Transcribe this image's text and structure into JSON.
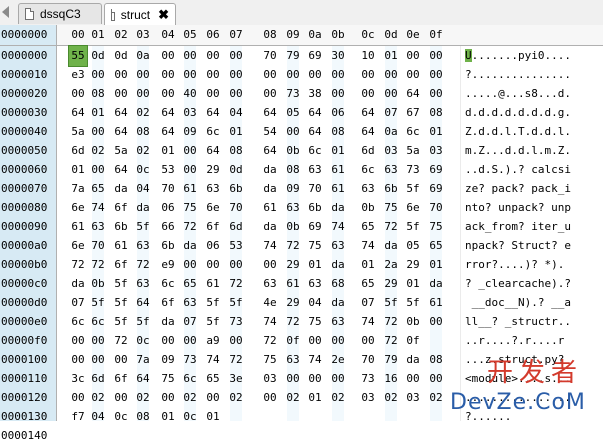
{
  "tabs": [
    {
      "label": "dssqC3",
      "active": false
    },
    {
      "label": "struct",
      "active": true,
      "close": "✖"
    }
  ],
  "header": {
    "address": "0000000",
    "columns": [
      "00",
      "01",
      "02",
      "03",
      "04",
      "05",
      "06",
      "07",
      "08",
      "09",
      "0a",
      "0b",
      "0c",
      "0d",
      "0e",
      "0f"
    ]
  },
  "rows": [
    {
      "addr": "0000000",
      "hex": [
        "55",
        "0d",
        "0d",
        "0a",
        "00",
        "00",
        "00",
        "00",
        "70",
        "79",
        "69",
        "30",
        "10",
        "01",
        "00",
        "00"
      ],
      "ascii": "U.......pyi0...."
    },
    {
      "addr": "0000010",
      "hex": [
        "e3",
        "00",
        "00",
        "00",
        "00",
        "00",
        "00",
        "00",
        "00",
        "00",
        "00",
        "00",
        "00",
        "00",
        "00",
        "00"
      ],
      "ascii": "?..............."
    },
    {
      "addr": "0000020",
      "hex": [
        "00",
        "08",
        "00",
        "00",
        "00",
        "40",
        "00",
        "00",
        "00",
        "73",
        "38",
        "00",
        "00",
        "00",
        "64",
        "00"
      ],
      "ascii": ".....@...s8...d."
    },
    {
      "addr": "0000030",
      "hex": [
        "64",
        "01",
        "64",
        "02",
        "64",
        "03",
        "64",
        "04",
        "64",
        "05",
        "64",
        "06",
        "64",
        "07",
        "67",
        "08"
      ],
      "ascii": "d.d.d.d.d.d.d.g."
    },
    {
      "addr": "0000040",
      "hex": [
        "5a",
        "00",
        "64",
        "08",
        "64",
        "09",
        "6c",
        "01",
        "54",
        "00",
        "64",
        "08",
        "64",
        "0a",
        "6c",
        "01"
      ],
      "ascii": "Z.d.d.l.T.d.d.l."
    },
    {
      "addr": "0000050",
      "hex": [
        "6d",
        "02",
        "5a",
        "02",
        "01",
        "00",
        "64",
        "08",
        "64",
        "0b",
        "6c",
        "01",
        "6d",
        "03",
        "5a",
        "03"
      ],
      "ascii": "m.Z...d.d.l.m.Z."
    },
    {
      "addr": "0000060",
      "hex": [
        "01",
        "00",
        "64",
        "0c",
        "53",
        "00",
        "29",
        "0d",
        "da",
        "08",
        "63",
        "61",
        "6c",
        "63",
        "73",
        "69"
      ],
      "ascii": "..d.S.).? calcsi"
    },
    {
      "addr": "0000070",
      "hex": [
        "7a",
        "65",
        "da",
        "04",
        "70",
        "61",
        "63",
        "6b",
        "da",
        "09",
        "70",
        "61",
        "63",
        "6b",
        "5f",
        "69"
      ],
      "ascii": "ze? pack? pack_i"
    },
    {
      "addr": "0000080",
      "hex": [
        "6e",
        "74",
        "6f",
        "da",
        "06",
        "75",
        "6e",
        "70",
        "61",
        "63",
        "6b",
        "da",
        "0b",
        "75",
        "6e",
        "70"
      ],
      "ascii": "nto? unpack? unp"
    },
    {
      "addr": "0000090",
      "hex": [
        "61",
        "63",
        "6b",
        "5f",
        "66",
        "72",
        "6f",
        "6d",
        "da",
        "0b",
        "69",
        "74",
        "65",
        "72",
        "5f",
        "75"
      ],
      "ascii": "ack_from? iter_u"
    },
    {
      "addr": "00000a0",
      "hex": [
        "6e",
        "70",
        "61",
        "63",
        "6b",
        "da",
        "06",
        "53",
        "74",
        "72",
        "75",
        "63",
        "74",
        "da",
        "05",
        "65"
      ],
      "ascii": "npack? Struct? e"
    },
    {
      "addr": "00000b0",
      "hex": [
        "72",
        "72",
        "6f",
        "72",
        "e9",
        "00",
        "00",
        "00",
        "00",
        "29",
        "01",
        "da",
        "01",
        "2a",
        "29",
        "01"
      ],
      "ascii": "rror?....)? *)."
    },
    {
      "addr": "00000c0",
      "hex": [
        "da",
        "0b",
        "5f",
        "63",
        "6c",
        "65",
        "61",
        "72",
        "63",
        "61",
        "63",
        "68",
        "65",
        "29",
        "01",
        "da"
      ],
      "ascii": "? _clearcache).?"
    },
    {
      "addr": "00000d0",
      "hex": [
        "07",
        "5f",
        "5f",
        "64",
        "6f",
        "63",
        "5f",
        "5f",
        "4e",
        "29",
        "04",
        "da",
        "07",
        "5f",
        "5f",
        "61"
      ],
      "ascii": " __doc__N).? __a"
    },
    {
      "addr": "00000e0",
      "hex": [
        "6c",
        "6c",
        "5f",
        "5f",
        "da",
        "07",
        "5f",
        "73",
        "74",
        "72",
        "75",
        "63",
        "74",
        "72",
        "0b",
        "00"
      ],
      "ascii": "ll__? _structr.."
    },
    {
      "addr": "00000f0",
      "hex": [
        "00",
        "00",
        "72",
        "0c",
        "00",
        "00",
        "a9",
        "00",
        "72",
        "0f",
        "00",
        "00",
        "00",
        "72",
        "0f",
        ""
      ],
      "ascii": "..r....?.r....r"
    },
    {
      "addr": "0000100",
      "hex": [
        "00",
        "00",
        "00",
        "7a",
        "09",
        "73",
        "74",
        "72",
        "75",
        "63",
        "74",
        "2e",
        "70",
        "79",
        "da",
        "08"
      ],
      "ascii": "...z.struct.py?"
    },
    {
      "addr": "0000110",
      "hex": [
        "3c",
        "6d",
        "6f",
        "64",
        "75",
        "6c",
        "65",
        "3e",
        "03",
        "00",
        "00",
        "00",
        "73",
        "16",
        "00",
        "00"
      ],
      "ascii": "<module>....s..."
    },
    {
      "addr": "0000120",
      "hex": [
        "00",
        "02",
        "00",
        "02",
        "00",
        "02",
        "00",
        "02",
        "00",
        "02",
        "01",
        "02",
        "03",
        "02",
        "03",
        "02"
      ],
      "ascii": "................"
    },
    {
      "addr": "0000130",
      "hex": [
        "f7",
        "04",
        "0c",
        "08",
        "01",
        "0c",
        "01",
        "",
        "",
        "",
        "",
        "",
        "",
        "",
        "",
        ""
      ],
      "ascii": "?......"
    },
    {
      "addr": "0000140",
      "hex": [
        "",
        "",
        "",
        "",
        "",
        "",
        "",
        "",
        "",
        "",
        "",
        "",
        "",
        "",
        "",
        ""
      ],
      "ascii": ""
    }
  ],
  "selection": {
    "row": 0,
    "col": 0,
    "color": "#6fb24a"
  },
  "colors": {
    "address_bg": "#d7eaf4",
    "header_bg": "#f7f7f7",
    "selection": "#6fb24a"
  },
  "watermark": {
    "line1": "开发者",
    "line2": "DevZe.CoM"
  }
}
